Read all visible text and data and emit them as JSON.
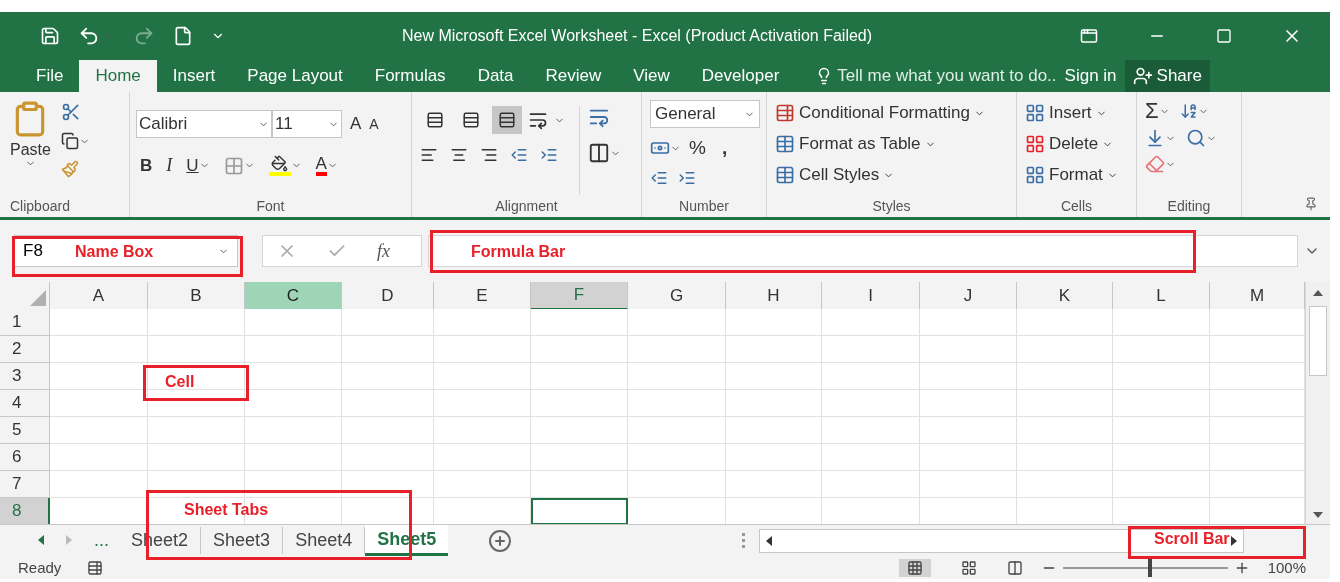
{
  "title_bar": {
    "title": "New Microsoft Excel Worksheet - Excel (Product Activation Failed)"
  },
  "menu_tabs": [
    {
      "label": "File",
      "selected": false
    },
    {
      "label": "Home",
      "selected": true
    },
    {
      "label": "Insert",
      "selected": false
    },
    {
      "label": "Page Layout",
      "selected": false
    },
    {
      "label": "Formulas",
      "selected": false
    },
    {
      "label": "Data",
      "selected": false
    },
    {
      "label": "Review",
      "selected": false
    },
    {
      "label": "View",
      "selected": false
    },
    {
      "label": "Developer",
      "selected": false
    }
  ],
  "tell_me": {
    "placeholder": "Tell me what you want to do.."
  },
  "sign_in": "Sign in",
  "share": "Share",
  "ribbon": {
    "clipboard": {
      "paste": "Paste",
      "label": "Clipboard"
    },
    "font": {
      "font_name": "Calibri",
      "font_size": "11",
      "grow": "A",
      "shrink": "A",
      "bold": "B",
      "italic": "I",
      "underline": "U",
      "font_color": "A",
      "label": "Font"
    },
    "alignment": {
      "vertical_align": [
        {
          "selected": false
        },
        {
          "selected": false
        },
        {
          "selected": true
        }
      ],
      "label": "Alignment"
    },
    "number": {
      "format": "General",
      "percent": "%",
      "comma": ",",
      "label": "Number"
    },
    "styles": {
      "buttons": [
        "Conditional Formatting",
        "Format as Table",
        "Cell Styles"
      ],
      "label": "Styles"
    },
    "cells": {
      "buttons": [
        "Insert",
        "Delete",
        "Format"
      ],
      "label": "Cells"
    },
    "editing": {
      "autosum": "Σ",
      "label": "Editing"
    }
  },
  "formula_bar": {
    "name_box": "F8",
    "fx": "fx",
    "name_box_callout": "Name Box",
    "formula_callout": "Formula Bar"
  },
  "grid": {
    "columns": [
      {
        "label": "A",
        "selected": false,
        "highlighted": false
      },
      {
        "label": "B",
        "selected": false,
        "highlighted": false
      },
      {
        "label": "C",
        "selected": false,
        "highlighted": true
      },
      {
        "label": "D",
        "selected": false,
        "highlighted": false
      },
      {
        "label": "E",
        "selected": false,
        "highlighted": false
      },
      {
        "label": "F",
        "selected": true,
        "highlighted": false
      },
      {
        "label": "G",
        "selected": false,
        "highlighted": false
      },
      {
        "label": "H",
        "selected": false,
        "highlighted": false
      },
      {
        "label": "I",
        "selected": false,
        "highlighted": false
      },
      {
        "label": "J",
        "selected": false,
        "highlighted": false
      },
      {
        "label": "K",
        "selected": false,
        "highlighted": false
      },
      {
        "label": "L",
        "selected": false,
        "highlighted": false
      },
      {
        "label": "M",
        "selected": false,
        "highlighted": false
      }
    ],
    "rows": [
      {
        "label": "1",
        "selected": false
      },
      {
        "label": "2",
        "selected": false
      },
      {
        "label": "3",
        "selected": false
      },
      {
        "label": "4",
        "selected": false
      },
      {
        "label": "5",
        "selected": false
      },
      {
        "label": "6",
        "selected": false
      },
      {
        "label": "7",
        "selected": false
      },
      {
        "label": "8",
        "selected": true
      }
    ],
    "callout": "Cell"
  },
  "sheet_tabs": {
    "overflow": "...",
    "tabs": [
      {
        "label": "Sheet2",
        "selected": false
      },
      {
        "label": "Sheet3",
        "selected": false
      },
      {
        "label": "Sheet4",
        "selected": false
      },
      {
        "label": "Sheet5",
        "selected": true
      }
    ],
    "callout": "Sheet Tabs"
  },
  "scroll_bar": {
    "callout": "Scroll Bar"
  },
  "status_bar": {
    "status": "Ready",
    "zoom": {
      "level": 0.53,
      "reading": "100%"
    }
  }
}
